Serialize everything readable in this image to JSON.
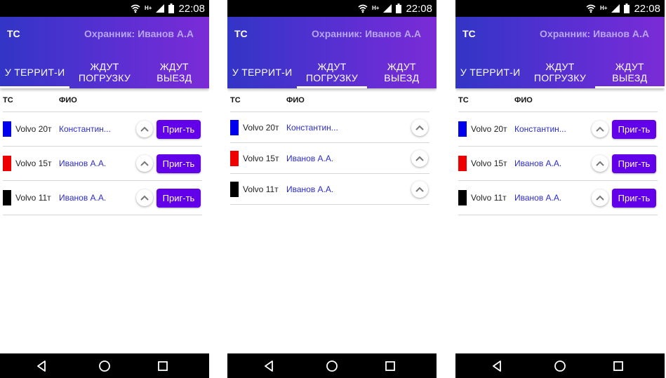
{
  "status_bar": {
    "time": "22:08",
    "network": "H+"
  },
  "app_bar": {
    "ts_label": "ТС",
    "guard_label": "Охранник: Иванов А.А"
  },
  "tabs": [
    {
      "label": "У ТЕРРИТ-И"
    },
    {
      "label": "ЖДУТ ПОГРУЗКУ"
    },
    {
      "label": "ЖДУТ ВЫЕЗД"
    }
  ],
  "table": {
    "columns": [
      "ТС",
      "ФИО"
    ],
    "button_label": "Приг-ть",
    "rows": [
      {
        "color": "#0000ee",
        "ts": "Volvo 20т",
        "fio": "Константин..."
      },
      {
        "color": "#ee0000",
        "ts": "Volvo 15т",
        "fio": "Иванов А.А."
      },
      {
        "color": "#000000",
        "ts": "Volvo 11т",
        "fio": "Иванов А.А."
      }
    ]
  },
  "screens": [
    {
      "active_tab": 0,
      "row_button": true
    },
    {
      "active_tab": 1,
      "row_button": false
    },
    {
      "active_tab": 2,
      "row_button": true
    }
  ],
  "icons": [
    "wifi-icon",
    "signal-icon",
    "battery-icon",
    "chevron-up-icon",
    "back-icon",
    "home-icon",
    "recents-icon"
  ],
  "colors": {
    "appbar_start": "#3235c6",
    "appbar_end": "#7b2bd6",
    "button": "#6200ea",
    "link": "#2c2cc8"
  }
}
